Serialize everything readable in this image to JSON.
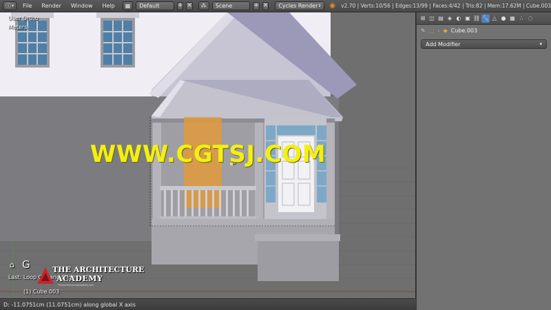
{
  "header": {
    "menus": [
      "File",
      "Render",
      "Window",
      "Help"
    ],
    "screen_layout": "Default",
    "scene": "Scene",
    "render_engine": "Cycles Render",
    "stats": "v2.70 | Verts:10/56 | Edges:13/99 | Faces:4/42 | Tris:82 | Mem:17.62M | Cube.003"
  },
  "viewport": {
    "view_name": "User Ortho",
    "units": "Meters",
    "watermark": "WWW.CGTSJ.COM",
    "key_display": "G",
    "last_operator": "Last: Loop Cut and Slide",
    "active_object": "(1) Cube.003",
    "logo_line1": "THE ARCHITECTURE",
    "logo_line2": "ACADEMY",
    "logo_tagline": "TheArchitectureAcademy.com"
  },
  "statusbar": {
    "text": "D: -11.0751cm (11.0751cm) along global X axis"
  },
  "properties": {
    "object_name": "Cube.003",
    "add_modifier": "Add Modifier",
    "active_tab": "modifiers"
  },
  "colors": {
    "accent": "#5680c2",
    "watermark": "#f3ef14",
    "selection": "#e09a3c"
  }
}
